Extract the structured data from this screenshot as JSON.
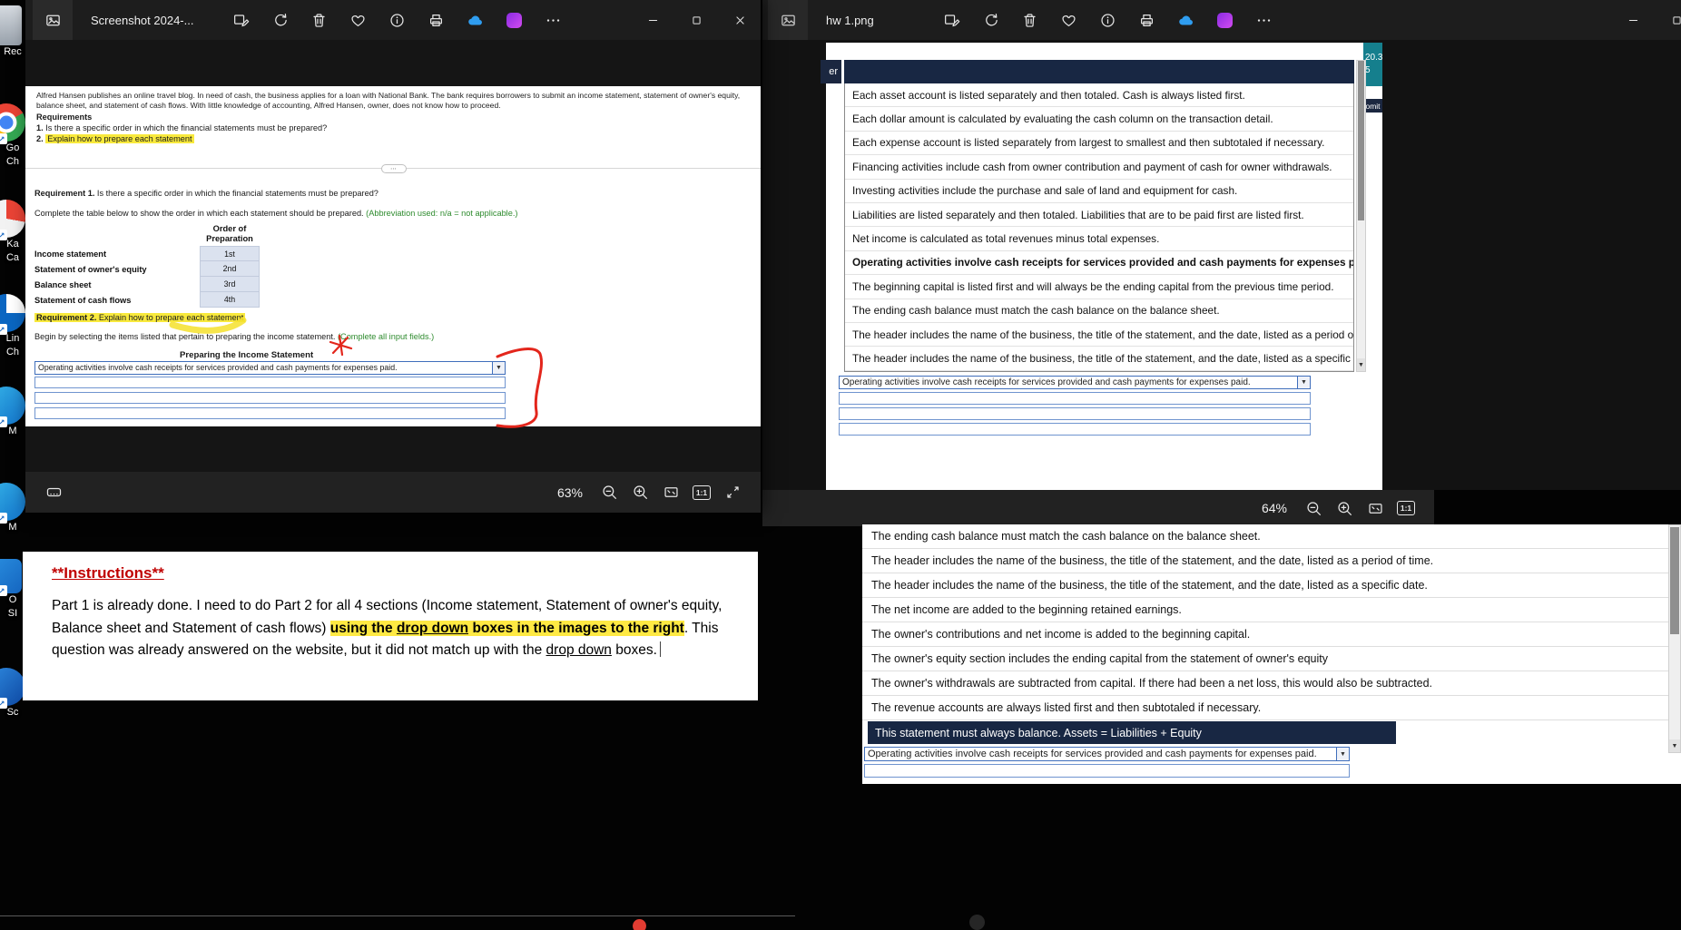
{
  "glyphs": {
    "down_arrow": "▼",
    "more_dots": "⋯",
    "shortcut_arrow": "↗",
    "one_to_one": "1:1"
  },
  "colors": {
    "highlight_yellow": "#f8e93c",
    "note_green": "#2e8b2e",
    "annotation_red": "#e02818",
    "selection_navy": "#182743",
    "dropdown_border_blue": "#3f6ebb",
    "onedrive_blue": "#2f9df0",
    "clipchamp_purple": "#a033e8",
    "teal_fragment": "#157f8d",
    "instructions_red": "#c00000"
  },
  "desktop": {
    "icons": [
      {
        "label1": "Rec",
        "label2": ""
      },
      {
        "label1": "Go",
        "label2": "Ch"
      },
      {
        "label1": "Ka",
        "label2": "Ca"
      },
      {
        "label1": "Lin",
        "label2": "Ch"
      },
      {
        "label1": "M",
        "label2": ""
      },
      {
        "label1": "M",
        "label2": ""
      },
      {
        "label1": "O",
        "label2": "SI"
      },
      {
        "label1": "Sc",
        "label2": ""
      }
    ]
  },
  "left_window": {
    "title": "Screenshot 2024-...",
    "zoom_level": "63%",
    "doc": {
      "intro": "Alfred Hansen publishes an online travel blog. In need of cash, the business applies for a loan with National Bank. The bank requires borrowers to submit an income statement, statement of owner's equity, balance sheet, and statement of cash flows. With little knowledge of accounting, Alfred Hansen, owner, does not know how to proceed.",
      "requirements_heading": "Requirements",
      "req1_num": "1.",
      "req1_text": " Is there a specific order in which the financial statements must be prepared?",
      "req2_num": "2.",
      "req2_text": "Explain how to prepare each statement",
      "requirement1_label": "Requirement 1.",
      "requirement1_text": " Is there a specific order in which the financial statements must be prepared?",
      "complete_table_text": "Complete the table below to show the order in which each statement should be prepared. ",
      "abbreviation_note": "(Abbreviation used: n/a = not applicable.)",
      "table": {
        "header_line1": "Order of",
        "header_line2": "Preparation",
        "rows": [
          {
            "label": "Income statement",
            "value": "1st"
          },
          {
            "label": "Statement of owner's equity",
            "value": "2nd"
          },
          {
            "label": "Balance sheet",
            "value": "3rd"
          },
          {
            "label": "Statement of cash flows",
            "value": "4th"
          }
        ]
      },
      "requirement2_label": "Requirement 2.",
      "requirement2_text": " Explain how to prepare each statement",
      "begin_text": "Begin by selecting the items listed that pertain to preparing the income statement. ",
      "complete_fields_note": "(Complete all input fields.)",
      "section_title": "Preparing the Income Statement",
      "dropdown_value": "Operating activities involve cash receipts for services provided and cash payments for expenses paid."
    }
  },
  "instructions": {
    "title": "**Instructions**",
    "seg1": "Part 1 is already done. I need to do Part 2 for all 4 sections (Income statement, Statement of owner's equity, Balance sheet and Statement of cash flows) ",
    "seg2": "using the ",
    "seg3": "drop down",
    "seg4": " boxes in the images to the right",
    "seg5": ".  This question was already answered on the website, but it did not match up with the ",
    "seg6": "drop down",
    "seg7": " boxes."
  },
  "right_window": {
    "title": "hw 1.png",
    "zoom_level": "64%",
    "fragments": {
      "teal_top": "20.3",
      "teal_bottom": "5",
      "omit": "omit",
      "er": "er"
    },
    "list_items": [
      "Each asset account is listed separately and then totaled. Cash is always listed first.",
      "Each dollar amount is calculated by evaluating the cash column on the transaction detail.",
      "Each expense account is listed separately from largest to smallest and then subtotaled if necessary.",
      "Financing activities include cash from owner contribution and payment of cash for owner withdrawals.",
      "Investing activities include the purchase and sale of land and equipment for cash.",
      "Liabilities are listed separately and then totaled. Liabilities that are to be paid first are listed first.",
      "Net income is calculated as total revenues minus total expenses.",
      "Operating activities involve cash receipts for services provided and cash payments for expenses paid.",
      "The beginning capital is listed first and will always be the ending capital from the previous time period.",
      "The ending cash balance must match the cash balance on the balance sheet.",
      "The header includes the name of the business, the title of the statement, and the date, listed as a period of time.",
      "The header includes the name of the business, the title of the statement, and the date, listed as a specific date."
    ],
    "dropdown_value": "Operating activities involve cash receipts for services provided and cash payments for expenses paid."
  },
  "bottom_panel": {
    "list_items": [
      "The ending cash balance must match the cash balance on the balance sheet.",
      "The header includes the name of the business, the title of the statement, and the date, listed as a period of time.",
      "The header includes the name of the business, the title of the statement, and the date, listed as a specific date.",
      "The net income are added to the beginning retained earnings.",
      "The owner's contributions and net income is added to the beginning capital.",
      "The owner's equity section includes the ending capital from the statement of owner's equity",
      "The owner's withdrawals are subtracted from capital. If there had been a net loss, this would also be subtracted.",
      "The revenue accounts are always listed first and then subtotaled if necessary."
    ],
    "selected_item": "This statement must always balance. Assets = Liabilities + Equity",
    "dropdown_value": "Operating activities involve cash receipts for services provided and cash payments for expenses paid."
  }
}
